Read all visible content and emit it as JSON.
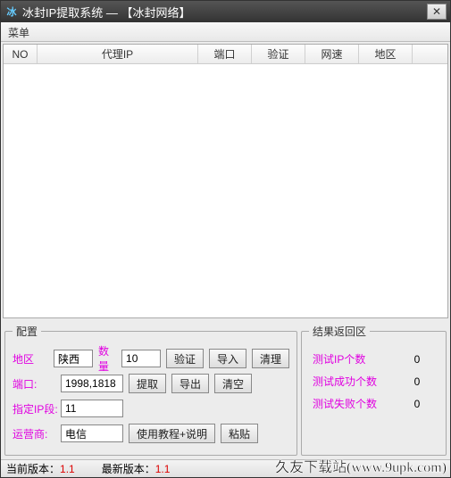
{
  "titlebar": {
    "icon_text": "冰",
    "title": "冰封IP提取系统  —  【冰封网络】"
  },
  "menubar": {
    "menu_label": "菜单"
  },
  "table": {
    "headers": {
      "no": "NO",
      "ip": "代理IP",
      "port": "端口",
      "verify": "验证",
      "speed": "网速",
      "region": "地区"
    }
  },
  "config": {
    "legend": "配置",
    "area_label": "地区",
    "area_value": "陕西",
    "qty_label": "数量",
    "qty_value": "10",
    "port_label": "端口:",
    "port_value": "1998,1818",
    "seg_label": "指定IP段:",
    "seg_value": "11",
    "isp_label": "运营商:",
    "isp_value": "电信",
    "btn_verify": "验证",
    "btn_import": "导入",
    "btn_cleanup": "清理",
    "btn_extract": "提取",
    "btn_export": "导出",
    "btn_clear": "清空",
    "btn_tutorial": "使用教程+说明",
    "btn_paste": "粘贴"
  },
  "results": {
    "legend": "结果返回区",
    "tested_label": "测试IP个数",
    "tested_value": "0",
    "ok_label": "测试成功个数",
    "ok_value": "0",
    "fail_label": "测试失败个数",
    "fail_value": "0"
  },
  "status": {
    "cur_label": "当前版本：",
    "cur_value": "1.1",
    "latest_label": "最新版本：",
    "latest_value": "1.1",
    "watermark": "久友下载站(www.9upk.com)"
  }
}
